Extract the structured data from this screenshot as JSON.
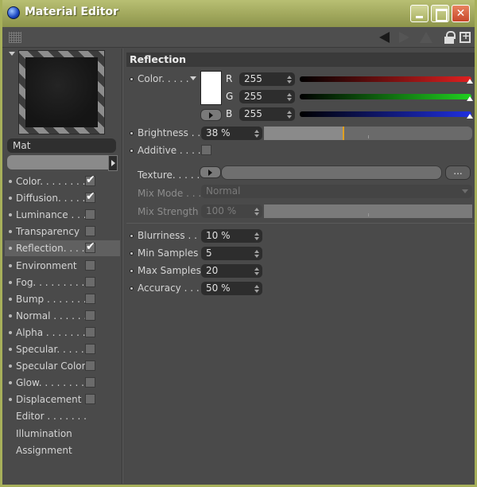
{
  "window": {
    "title": "Material Editor"
  },
  "material": {
    "name": "Mat"
  },
  "channels": [
    {
      "label": "Color. . . . . . . .",
      "checked": true,
      "dot": true
    },
    {
      "label": "Diffusion. . . . .",
      "checked": true,
      "dot": true
    },
    {
      "label": "Luminance . . .",
      "checked": false,
      "dot": true
    },
    {
      "label": "Transparency",
      "checked": false,
      "dot": true
    },
    {
      "label": "Reflection. . . .",
      "checked": true,
      "dot": true,
      "active": true
    },
    {
      "label": "Environment",
      "checked": false,
      "dot": true
    },
    {
      "label": "Fog. . . . . . . . .",
      "checked": false,
      "dot": true
    },
    {
      "label": "Bump . . . . . . .",
      "checked": false,
      "dot": true
    },
    {
      "label": "Normal . . . . . .",
      "checked": false,
      "dot": true
    },
    {
      "label": "Alpha . . . . . . .",
      "checked": false,
      "dot": true
    },
    {
      "label": "Specular. . . . .",
      "checked": false,
      "dot": true
    },
    {
      "label": "Specular Color",
      "checked": false,
      "dot": true
    },
    {
      "label": "Glow. . . . . . . .",
      "checked": false,
      "dot": true
    },
    {
      "label": "Displacement",
      "checked": false,
      "dot": true
    },
    {
      "label": "Editor . . . . . . .",
      "checked": null,
      "dot": false
    },
    {
      "label": "Illumination",
      "checked": null,
      "dot": false
    },
    {
      "label": "Assignment",
      "checked": null,
      "dot": false
    }
  ],
  "reflection": {
    "header": "Reflection",
    "color_label": "Color. . . . .",
    "r_label": "R",
    "g_label": "G",
    "b_label": "B",
    "r_value": "255",
    "g_value": "255",
    "b_value": "255",
    "swatch_color": "#ffffff",
    "brightness_label": "Brightness . .",
    "brightness_value": "38 %",
    "brightness_fraction": 0.38,
    "additive_label": "Additive . . . .",
    "texture_label": "Texture. . . . .",
    "texture_button": "...",
    "mix_mode_label": "Mix Mode . . .",
    "mix_mode_value": "Normal",
    "mix_strength_label": "Mix Strength",
    "mix_strength_value": "100 %",
    "blurriness_label": "Blurriness . . .",
    "blurriness_value": "10 %",
    "min_samples_label": "Min Samples",
    "min_samples_value": "5",
    "max_samples_label": "Max Samples",
    "max_samples_value": "20",
    "accuracy_label": "Accuracy . . .",
    "accuracy_value": "50 %"
  },
  "colors": {
    "accent_handle": "#e0a020",
    "red": "#e02020",
    "green": "#20d020",
    "blue": "#2030e0"
  }
}
